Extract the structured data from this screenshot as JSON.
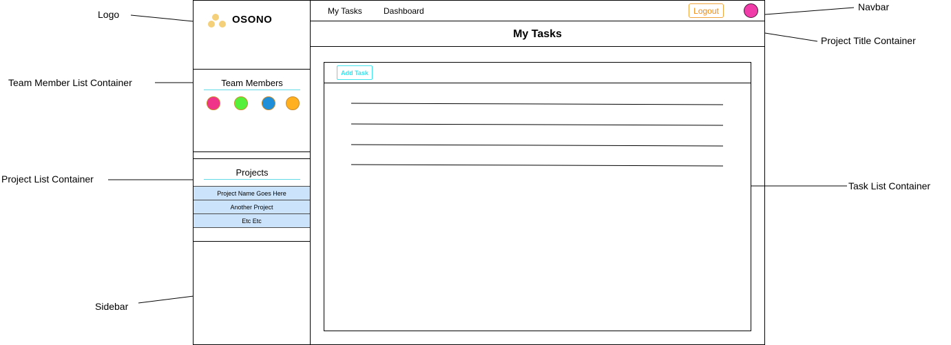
{
  "brand": {
    "name": "OSONO"
  },
  "navbar": {
    "links": [
      "My Tasks",
      "Dashboard"
    ],
    "logout_label": "Logout"
  },
  "page": {
    "title": "My Tasks"
  },
  "team": {
    "title": "Team Members",
    "members": [
      {
        "color": "#f0348a"
      },
      {
        "color": "#54f03a"
      },
      {
        "color": "#1e8fd8"
      },
      {
        "color": "#ffb020"
      }
    ]
  },
  "projects": {
    "title": "Projects",
    "items": [
      "Project Name Goes Here",
      "Another Project",
      "Etc Etc"
    ]
  },
  "tasks": {
    "add_label": "Add Task",
    "row_count": 4
  },
  "callouts": {
    "logo": "Logo",
    "team_member_list": "Team Member List Container",
    "project_list": "Project List Container",
    "sidebar": "Sidebar",
    "navbar": "Navbar",
    "project_title": "Project Title Container",
    "task_list": "Task List Container"
  },
  "colors": {
    "accent_cyan": "#3ee3ee",
    "logout_orange": "#f08a10",
    "project_item_bg": "#cce4fb",
    "avatar": "#f03ca8",
    "logo_dots": "#f5d07a"
  }
}
